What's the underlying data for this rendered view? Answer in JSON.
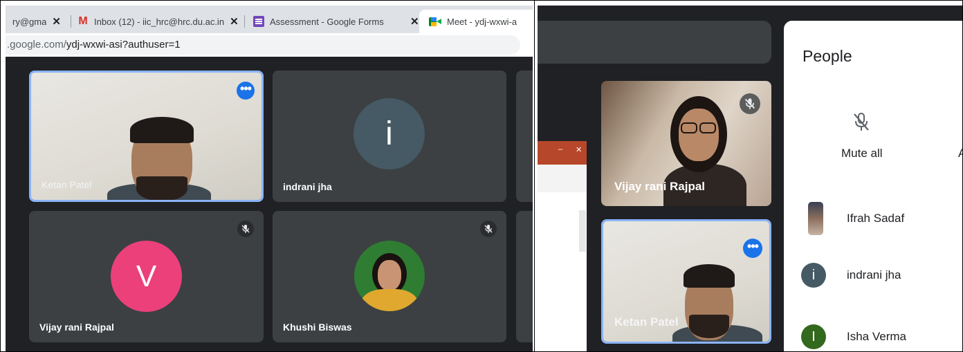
{
  "left": {
    "tabs": [
      {
        "label": "ry@gma",
        "close": "✕"
      },
      {
        "label": "Inbox (12) - iic_hrc@hrc.du.ac.in",
        "close": "✕"
      },
      {
        "label": "Assessment - Google Forms",
        "close": "✕"
      },
      {
        "label": "Meet - ydj-wxwi-a",
        "close": ""
      }
    ],
    "url": {
      "prefix": ".google.com/",
      "path": "ydj-wxwi-asi?authuser=1"
    },
    "tiles": [
      {
        "name": "Ketan Patel",
        "type": "video"
      },
      {
        "name": "indrani jha",
        "type": "avatar",
        "initial": "i",
        "color": "#455a64"
      },
      {
        "name": "Vijay rani Rajpal",
        "type": "avatar",
        "initial": "V",
        "color": "#ec407a"
      },
      {
        "name": "Khushi Biswas",
        "type": "photo-avatar"
      }
    ]
  },
  "right": {
    "tiles": [
      {
        "name": "Vijay rani Rajpal"
      },
      {
        "name": "Ketan Patel"
      }
    ],
    "window_controls": {
      "min": "–",
      "max": "□",
      "close": "✕"
    },
    "people_panel": {
      "title": "People",
      "mute_all_label": "Mute all",
      "cut_label": "A",
      "participants": [
        {
          "name": "Ifrah Sadaf",
          "avatar": "photo"
        },
        {
          "name": "indrani jha",
          "initial": "i",
          "color": "#455a64"
        },
        {
          "name": "Isha Verma",
          "initial": "I",
          "color": "#33691e"
        }
      ]
    }
  },
  "icons": {
    "mic_off": "mic-off-icon",
    "more": "more-options-icon"
  },
  "colors": {
    "accent": "#1a73e8",
    "speaking_border": "#8ab4f8",
    "tile_bg": "#3c4043",
    "meet_bg": "#202124"
  }
}
